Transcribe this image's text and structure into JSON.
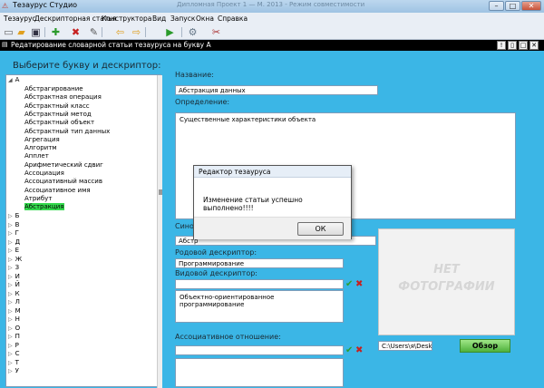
{
  "app": {
    "title": "Тезаурус Студио",
    "faint_title": "Дипломная Проект 1 — М. 2013 - Режим совместимости",
    "window_buttons": {
      "minimize": "–",
      "maximize": "□",
      "close": "✕"
    }
  },
  "menu": [
    "Тезаурус",
    "Дескрипторная статья",
    "Конструктора",
    "Вид",
    "Запуск",
    "Окна",
    "Справка"
  ],
  "toolbar": {
    "icons": [
      "new-document-icon",
      "open-folder-icon",
      "save-icon",
      "add-icon",
      "delete-icon",
      "edit-icon",
      "back-arrow-icon",
      "forward-arrow-icon",
      "run-icon",
      "search-icon",
      "tools-icon"
    ]
  },
  "child_window": {
    "title": "Редатирование словарной статьи тезауруса на букву А",
    "buttons": {
      "info": "!",
      "restore": "▯",
      "maximize": "□",
      "close": "✕"
    }
  },
  "sidebar": {
    "header": "Выберите букву и дескриптор:",
    "root_letter": "А",
    "items": [
      "Абстрагирование",
      "Абстрактная операция",
      "Абстрактный класс",
      "Абстрактный метод",
      "Абстрактный объект",
      "Абстрактный тип данных",
      "Агрегация",
      "Алгоритм",
      "Апплет",
      "Арифметический сдвиг",
      "Ассоциация",
      "Ассоциативный массив",
      "Ассоциативное имя",
      "Атрибут",
      "Абстракция"
    ],
    "selected_item": "Абстракция",
    "letters": [
      "Б",
      "В",
      "Г",
      "Д",
      "Е",
      "Ж",
      "З",
      "И",
      "Й",
      "К",
      "Л",
      "М",
      "Н",
      "О",
      "П",
      "Р",
      "С",
      "Т",
      "У"
    ]
  },
  "form": {
    "name_label": "Название:",
    "name_value": "Абстракция данных",
    "definition_label": "Определение:",
    "definition_value": "Существенные характеристики объекта",
    "synonym_label": "Сино",
    "synonym_value": "Абстр",
    "generic_label": "Родовой дескриптор:",
    "generic_value": "Программирование",
    "specific_label": "Видовой дескриптор:",
    "specific_list": [
      "Объектно-ориентированное программирование"
    ],
    "assoc_label": "Ассоциативное отношение:",
    "photo_text_line1": "НЕТ",
    "photo_text_line2": "ФОТОГРАФИИ",
    "photo_path": "C:\\Users\\я\\Deskto",
    "browse_label": "Обзор",
    "check_glyph": "✔",
    "x_glyph": "✖"
  },
  "dialog": {
    "title": "Редактор тезауруса",
    "message": "Изменение статьи успешно выполнено!!!!",
    "ok_label": "ОК"
  },
  "colors": {
    "background": "#3bb6e6",
    "selected": "#33d94d",
    "browse": "#4fb13b"
  }
}
